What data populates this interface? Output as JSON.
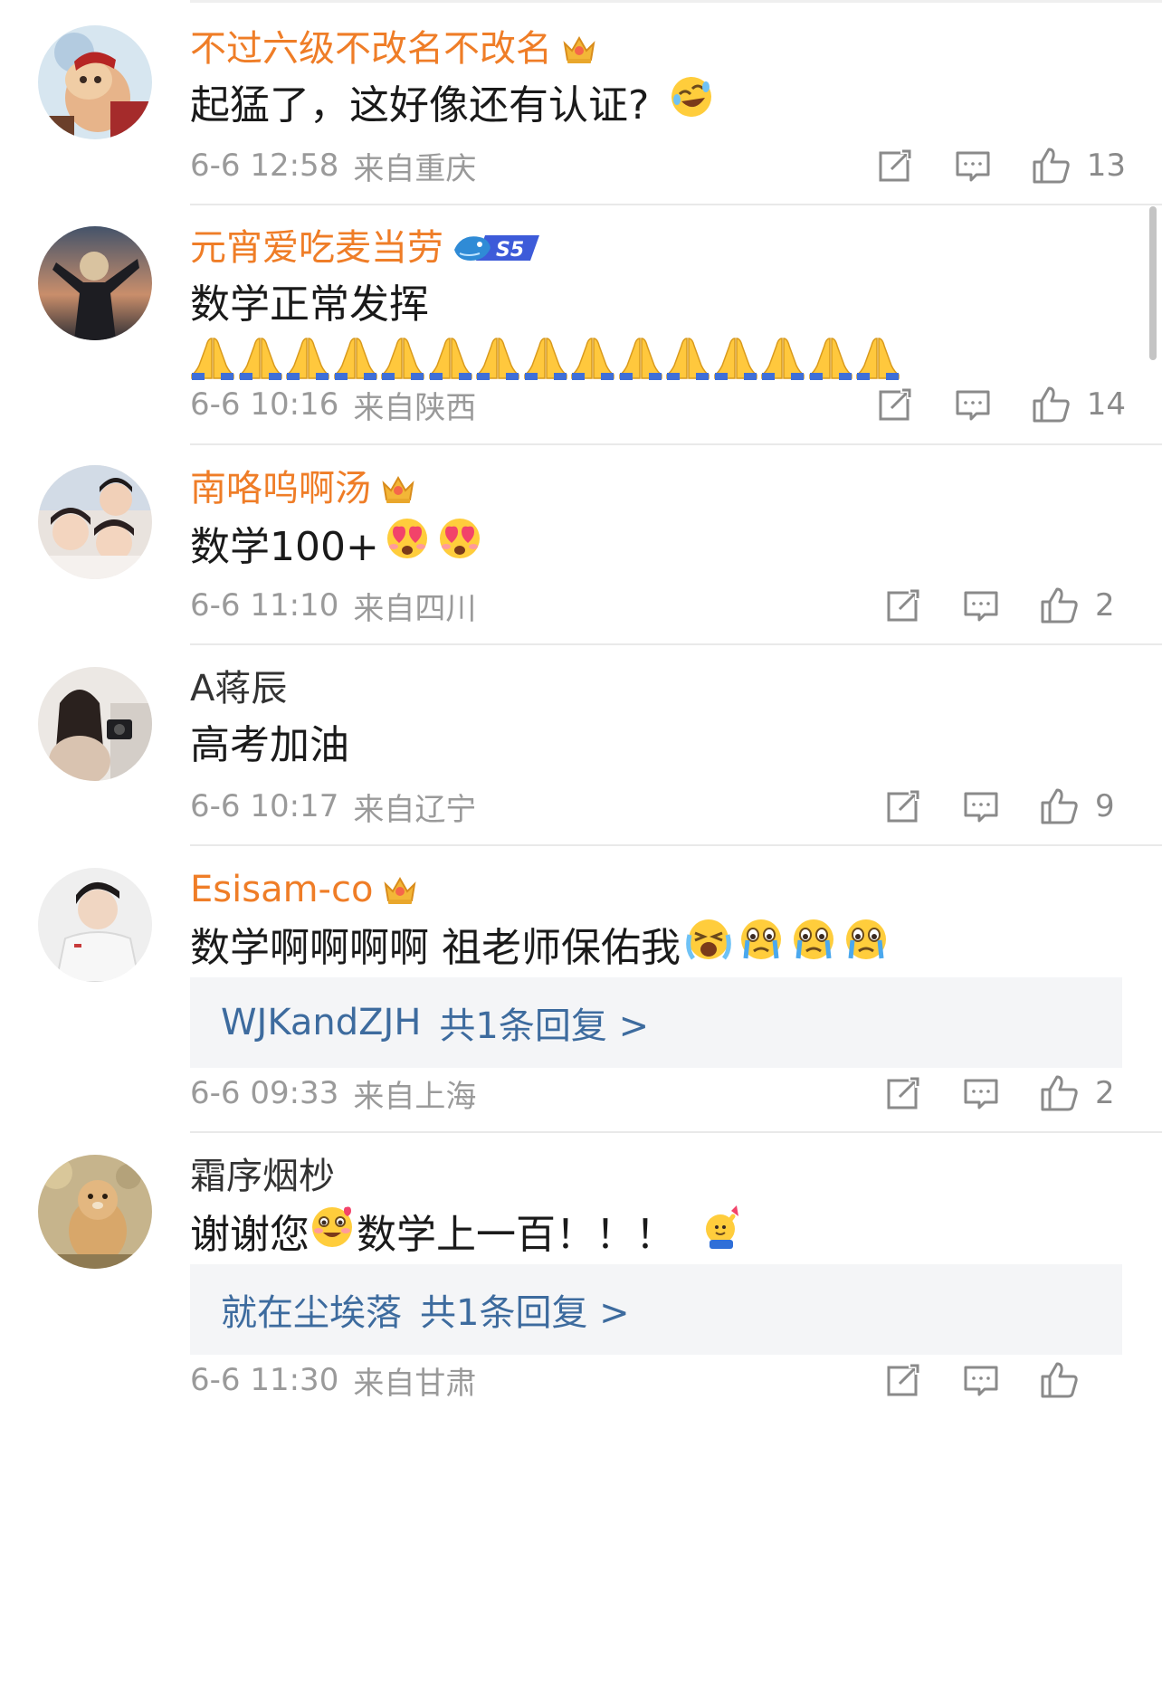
{
  "comments": [
    {
      "username": "不过六级不改名不改名",
      "vip": true,
      "badge": "crown-icon",
      "text": "起猛了，这好像还有认证?",
      "emojis": [
        "laughing-emoji"
      ],
      "reply": null,
      "time": "6-6 12:58",
      "location": "来自重庆",
      "likes": "13"
    },
    {
      "username": "元宵爱吃麦当劳",
      "vip": true,
      "badge": "s5-badge",
      "badge_label": "S5",
      "text": "数学正常发挥",
      "emojis": [
        "pray-emoji"
      ],
      "pray_count": 15,
      "reply": null,
      "time": "6-6 10:16",
      "location": "来自陕西",
      "likes": "14"
    },
    {
      "username": "南咯呜啊汤",
      "vip": true,
      "badge": "crown-icon",
      "text": "数学100+",
      "emojis": [
        "heart-eyes-emoji",
        "heart-eyes-emoji"
      ],
      "reply": null,
      "time": "6-6 11:10",
      "location": "来自四川",
      "likes": "2"
    },
    {
      "username": "A蒋辰",
      "vip": false,
      "badge": null,
      "text": "高考加油",
      "emojis": [],
      "reply": null,
      "time": "6-6 10:17",
      "location": "来自辽宁",
      "likes": "9"
    },
    {
      "username": "Esisam-co",
      "vip": true,
      "badge": "crown-icon",
      "text": "数学啊啊啊啊 祖老师保佑我",
      "emojis": [
        "crying-loud-emoji",
        "crying-emoji",
        "crying-emoji",
        "crying-emoji"
      ],
      "reply": {
        "author": "WJKandZJH",
        "count": "共1条回复 >"
      },
      "time": "6-6 09:33",
      "location": "来自上海",
      "likes": "2"
    },
    {
      "username": "霜序烟杪",
      "vip": false,
      "badge": null,
      "text_before": "谢谢您",
      "text_after": "数学上一百！！！",
      "emojis": [
        "flirty-emoji",
        "cheer-emoji"
      ],
      "reply": {
        "author": "就在尘埃落",
        "count": "共1条回复 >"
      },
      "time": "6-6 11:30",
      "location": "来自甘肃",
      "likes": ""
    }
  ],
  "colors": {
    "vip_name": "#ef7d27",
    "reply_link": "#3d6b9e",
    "meta": "#9a9a9a",
    "divider": "#e9e9e9",
    "reply_bg": "#f4f5f7"
  },
  "icons": {
    "share": "share-icon",
    "comment": "comment-icon",
    "like": "like-icon"
  }
}
